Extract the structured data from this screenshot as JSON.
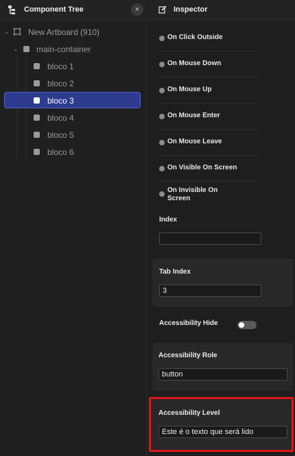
{
  "left_panel": {
    "title": "Component Tree",
    "close_symbol": "×",
    "tree": {
      "artboard": "New Artboard (910)",
      "container": "main-container",
      "items": [
        "bloco 1",
        "bloco 2",
        "bloco 3",
        "bloco 4",
        "bloco 5",
        "bloco 6"
      ],
      "selected": "bloco 3"
    }
  },
  "inspector": {
    "title": "Inspector",
    "events": [
      "On Click Outside",
      "On Mouse Down",
      "On Mouse Up",
      "On Mouse Enter",
      "On Mouse Leave",
      "On Visible On Screen",
      "On Invisible On Screen"
    ],
    "index": {
      "label": "Index",
      "value": ""
    },
    "tab_index": {
      "label": "Tab Index",
      "value": "3"
    },
    "accessibility_hide": {
      "label": "Accessibility Hide",
      "on": false
    },
    "accessibility_role": {
      "label": "Accessibility Role",
      "value": "button"
    },
    "accessibility_level": {
      "label": "Accessibility Level",
      "value": "Este é o texto que será lido"
    }
  },
  "colors": {
    "selection": "#2f3b8f",
    "highlight": "#e01818"
  }
}
